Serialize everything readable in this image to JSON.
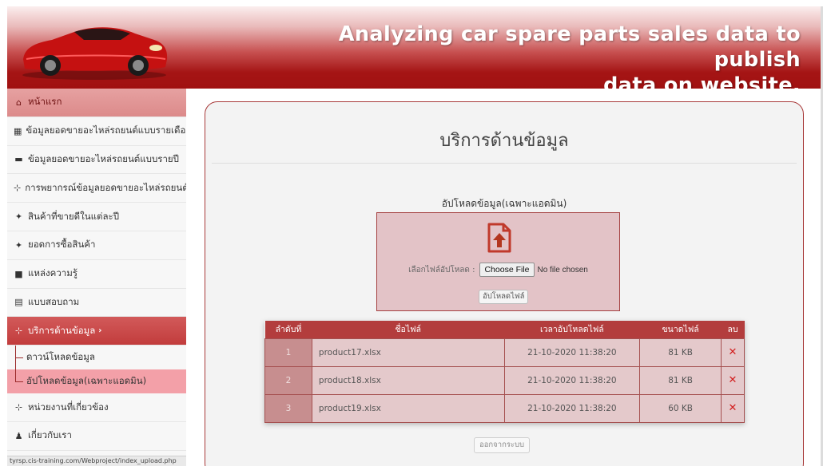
{
  "header": {
    "title_line1": "Analyzing car spare parts sales data to publish",
    "title_line2": "data on website."
  },
  "sidebar": {
    "items": [
      {
        "label": "หน้าแรก",
        "icon": "home-icon"
      },
      {
        "label": "ข้อมูลยอดขายอะไหล่รถยนต์แบบรายเดือน",
        "icon": "calendar-icon",
        "chevron": "›"
      },
      {
        "label": "ข้อมูลยอดขายอะไหล่รถยนต์แบบรายปี",
        "icon": "calendar-icon"
      },
      {
        "label": "การพยากรณ์ข้อมูลยอดขายอะไหล่รถยนต์",
        "icon": "sitemap-icon",
        "chevron": "›"
      },
      {
        "label": "สินค้าที่ขายดีในแต่ละปี",
        "icon": "magic-icon"
      },
      {
        "label": "ยอดการซื้อสินค้า",
        "icon": "magic-icon"
      },
      {
        "label": "แหล่งความรู้",
        "icon": "book-icon"
      },
      {
        "label": "แบบสอบถาม",
        "icon": "document-icon"
      },
      {
        "label": "บริการด้านข้อมูล",
        "icon": "sitemap-icon",
        "chevron": "›"
      },
      {
        "label": "หน่วยงานที่เกี่ยวข้อง",
        "icon": "sitemap-icon"
      },
      {
        "label": "เกี่ยวกับเรา",
        "icon": "user-icon"
      }
    ],
    "sub_items": [
      {
        "label": "ดาวน์โหลดข้อมูล"
      },
      {
        "label": "อัปโหลดข้อมูล(เฉพาะแอดมิน)"
      }
    ],
    "status_url": "tyrsp.cis-training.com/Webproject/index_upload.php"
  },
  "main": {
    "title": "บริการด้านข้อมูล",
    "upload_caption": "อัปโหลดข้อมูล(เฉพาะแอดมิน)",
    "file_label": "เลือกไฟล์อัปโหลด :",
    "choose_file": "Choose File",
    "no_file": "No file chosen",
    "upload_button": "อัปโหลดไฟล์",
    "table": {
      "headers": [
        "ลำดับที่",
        "ชื่อไฟล์",
        "เวลาอัปโหลดไฟล์",
        "ขนาดไฟล์",
        "ลบ"
      ],
      "rows": [
        {
          "no": "1",
          "name": "product17.xlsx",
          "time": "21-10-2020 11:38:20",
          "size": "81 KB"
        },
        {
          "no": "2",
          "name": "product18.xlsx",
          "time": "21-10-2020 11:38:20",
          "size": "81 KB"
        },
        {
          "no": "3",
          "name": "product19.xlsx",
          "time": "21-10-2020 11:38:20",
          "size": "60 KB"
        }
      ],
      "delete_glyph": "✕"
    },
    "logout_button": "ออกจากระบบ"
  },
  "colors": {
    "brand": "#a51515",
    "active": "#c23c3c",
    "box": "#e3c3c7"
  }
}
